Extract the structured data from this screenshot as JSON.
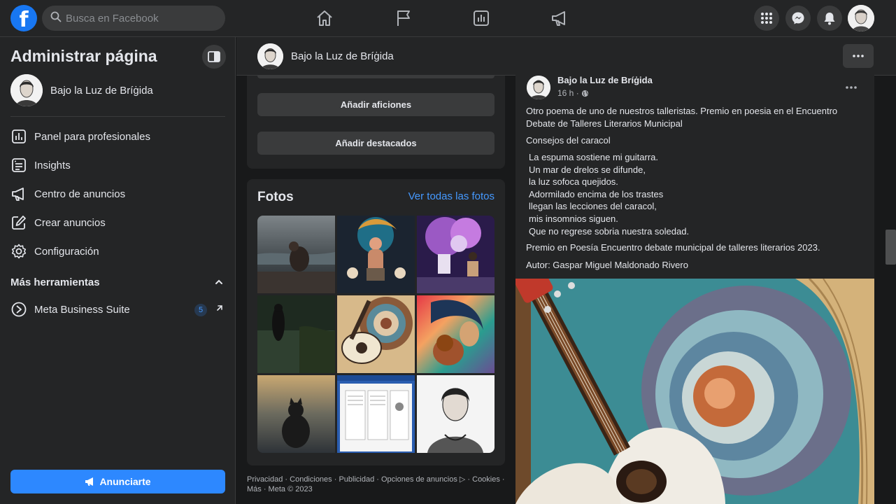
{
  "topbar": {
    "logo": "f",
    "search_placeholder": "Busca en Facebook",
    "nav_icons": [
      "home-icon",
      "flag-icon",
      "insights-icon",
      "megaphone-icon"
    ],
    "right_icons": [
      "menu-grid-icon",
      "messenger-icon",
      "notifications-icon"
    ]
  },
  "sidebar": {
    "title": "Administrar página",
    "page_name": "Bajo la Luz de Bríġida",
    "items": [
      {
        "label": "Panel para profesionales",
        "icon": "dashboard-icon"
      },
      {
        "label": "Insights",
        "icon": "insights-icon"
      },
      {
        "label": "Centro de anuncios",
        "icon": "megaphone-icon"
      },
      {
        "label": "Crear anuncios",
        "icon": "edit-icon"
      },
      {
        "label": "Configuración",
        "icon": "gear-icon"
      }
    ],
    "more_tools": "Más herramientas",
    "meta_suite": {
      "label": "Meta Business Suite",
      "badge": "5"
    },
    "advertise_button": "Anunciarte"
  },
  "page_header": {
    "name": "Bajo la Luz de Bríġida"
  },
  "about_card": {
    "buttons": [
      "Añadir aficiones",
      "Añadir destacados"
    ]
  },
  "photos": {
    "title": "Fotos",
    "see_all": "Ver todas las fotos"
  },
  "footer": {
    "line1": "Privacidad · Condiciones · Publicidad · Opciones de anuncios ▷ · Cookies ·",
    "line2": "Más · Meta © 2023"
  },
  "post": {
    "author": "Bajo la Luz de Bríġida",
    "time": "16 h ·",
    "intro": "Otro poema de uno de nuestros talleristas. Premio en poesia en el Encuentro Debate de Talleres Literarios  Municipal",
    "poem_title": "Consejos del caracol",
    "poem_lines": [
      "La espuma sostiene mi guitarra.",
      "Un mar de drelos se difunde,",
      "la luz sofoca quejidos.",
      "Adormilado encima de los trastes",
      "llegan las lecciones del caracol,",
      "mis insomnios siguen.",
      "Que no regrese sobria nuestra soledad."
    ],
    "award": "Premio en Poesía Encuentro debate  municipal de talleres literarios 2023.",
    "author_line": "Autor: Gaspar Miguel Maldonado Rivero"
  },
  "colors": {
    "background": "#18191a",
    "surface": "#242526",
    "accent": "#2d88ff",
    "link": "#4599ff"
  }
}
